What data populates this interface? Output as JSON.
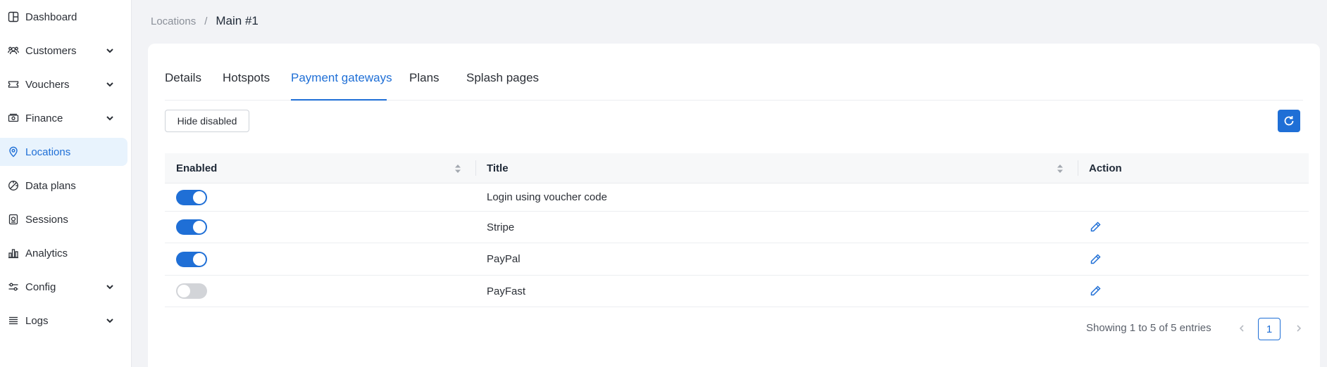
{
  "sidebar": {
    "items": [
      {
        "label": "Dashboard",
        "icon": "dashboard-icon",
        "has_chevron": false,
        "active": false
      },
      {
        "label": "Customers",
        "icon": "customers-icon",
        "has_chevron": true,
        "active": false
      },
      {
        "label": "Vouchers",
        "icon": "voucher-icon",
        "has_chevron": true,
        "active": false
      },
      {
        "label": "Finance",
        "icon": "money-icon",
        "has_chevron": true,
        "active": false
      },
      {
        "label": "Locations",
        "icon": "location-pin-icon",
        "has_chevron": false,
        "active": true
      },
      {
        "label": "Data plans",
        "icon": "data-plan-icon",
        "has_chevron": false,
        "active": false
      },
      {
        "label": "Sessions",
        "icon": "sessions-icon",
        "has_chevron": false,
        "active": false
      },
      {
        "label": "Analytics",
        "icon": "analytics-icon",
        "has_chevron": false,
        "active": false
      },
      {
        "label": "Config",
        "icon": "sliders-icon",
        "has_chevron": true,
        "active": false
      },
      {
        "label": "Logs",
        "icon": "list-icon",
        "has_chevron": true,
        "active": false
      }
    ]
  },
  "breadcrumb": {
    "parent": "Locations",
    "separator": "/",
    "current": "Main #1"
  },
  "tabs": [
    {
      "label": "Details",
      "active": false
    },
    {
      "label": "Hotspots",
      "active": false
    },
    {
      "label": "Payment gateways",
      "active": true
    },
    {
      "label": "Plans",
      "active": false
    },
    {
      "label": "Splash pages",
      "active": false
    }
  ],
  "toolbar": {
    "hide_disabled_label": "Hide disabled",
    "refresh_icon": "refresh-icon"
  },
  "table": {
    "columns": [
      "Enabled",
      "Title",
      "Action"
    ],
    "rows": [
      {
        "enabled": true,
        "title": "Login using voucher code",
        "editable": false
      },
      {
        "enabled": true,
        "title": "Stripe",
        "editable": true
      },
      {
        "enabled": true,
        "title": "PayPal",
        "editable": true
      },
      {
        "enabled": false,
        "title": "PayFast",
        "editable": true
      }
    ]
  },
  "pagination": {
    "showing": "Showing 1 to 5 of 5 entries",
    "current_page": "1"
  },
  "colors": {
    "accent": "#1f6fd6",
    "active_bg": "#e8f3fd",
    "toggle_off": "#d2d4d8"
  }
}
